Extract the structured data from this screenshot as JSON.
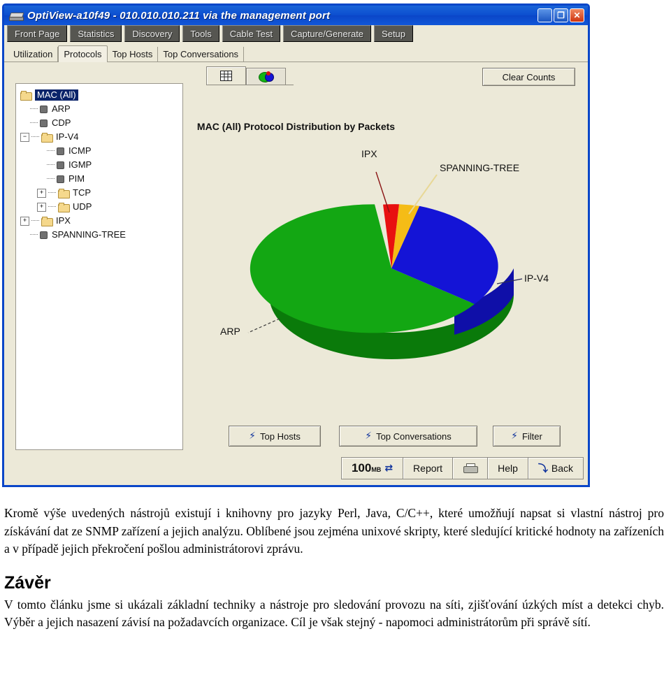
{
  "window": {
    "title": "OptiView-a10f49 - 010.010.010.211 via the management port",
    "icon": "device-icon",
    "minimize_label": "_",
    "maximize_label": "❐",
    "close_label": "✕"
  },
  "main_tabs": [
    {
      "label": "Front Page"
    },
    {
      "label": "Statistics"
    },
    {
      "label": "Discovery"
    },
    {
      "label": "Tools"
    },
    {
      "label": "Cable Test"
    },
    {
      "label": "Capture/Generate"
    },
    {
      "label": "Setup"
    }
  ],
  "sub_tabs": [
    {
      "label": "Utilization",
      "active": false
    },
    {
      "label": "Protocols",
      "active": true
    },
    {
      "label": "Top Hosts",
      "active": false
    },
    {
      "label": "Top Conversations",
      "active": false
    }
  ],
  "tree": [
    {
      "label": "MAC (All)",
      "depth": 0,
      "type": "folder",
      "toggle": "none",
      "selected": true
    },
    {
      "label": "ARP",
      "depth": 1,
      "type": "leaf",
      "toggle": "none",
      "selected": false
    },
    {
      "label": "CDP",
      "depth": 1,
      "type": "leaf",
      "toggle": "none",
      "selected": false
    },
    {
      "label": "IP-V4",
      "depth": 1,
      "type": "folder",
      "toggle": "minus",
      "selected": false
    },
    {
      "label": "ICMP",
      "depth": 2,
      "type": "leaf",
      "toggle": "none",
      "selected": false
    },
    {
      "label": "IGMP",
      "depth": 2,
      "type": "leaf",
      "toggle": "none",
      "selected": false
    },
    {
      "label": "PIM",
      "depth": 2,
      "type": "leaf",
      "toggle": "none",
      "selected": false
    },
    {
      "label": "TCP",
      "depth": 2,
      "type": "folder",
      "toggle": "plus",
      "selected": false
    },
    {
      "label": "UDP",
      "depth": 2,
      "type": "folder",
      "toggle": "plus",
      "selected": false
    },
    {
      "label": "IPX",
      "depth": 1,
      "type": "folder",
      "toggle": "plus",
      "selected": false
    },
    {
      "label": "SPANNING-TREE",
      "depth": 1,
      "type": "leaf",
      "toggle": "none",
      "selected": false
    }
  ],
  "view_tabs": [
    {
      "icon": "table-view-icon",
      "active": false
    },
    {
      "icon": "pie-chart-view-icon",
      "active": true
    }
  ],
  "toolbar": {
    "clear_counts_label": "Clear Counts"
  },
  "chart_data": {
    "type": "pie",
    "title": "MAC (All) Protocol Distribution by Packets",
    "labels": [
      "ARP",
      "IP-V4",
      "SPANNING-TREE",
      "IPX"
    ],
    "values": [
      62,
      31,
      4,
      3
    ],
    "colors": [
      "#13a713",
      "#1414d6",
      "#f5bc16",
      "#e81010"
    ],
    "legend": "callout-labels",
    "three_d": true
  },
  "actions": [
    {
      "label": "Top Hosts",
      "icon": "lightning-icon"
    },
    {
      "label": "Top Conversations",
      "icon": "lightning-icon"
    },
    {
      "label": "Filter",
      "icon": "lightning-icon"
    }
  ],
  "status": {
    "speed_value": "100",
    "speed_unit": "MB",
    "speed_icon": "bidirectional-arrows-icon",
    "report_label": "Report",
    "print_icon": "printer-icon",
    "help_label": "Help",
    "back_label": "Back",
    "back_icon": "back-arrow-icon"
  },
  "article": {
    "paragraph1": "Kromě výše uvedených nástrojů existují i knihovny pro jazyky Perl, Java, C/C++, které umožňují napsat si vlastní nástroj pro získávání dat ze SNMP zařízení a jejich analýzu. Oblíbené jsou zejména unixové skripty, které sledující kritické hodnoty na zařízeních a v případě jejich překročení pošlou administrátorovi zprávu.",
    "heading": "Závěr",
    "paragraph2": "V tomto článku jsme si ukázali základní techniky  a nástroje pro sledování provozu na síti, zjišťování úzkých míst a detekci chyb. Výběr a jejich nasazení závisí na požadavcích organizace. Cíl je však stejný - napomoci administrátorům při správě sítí."
  }
}
